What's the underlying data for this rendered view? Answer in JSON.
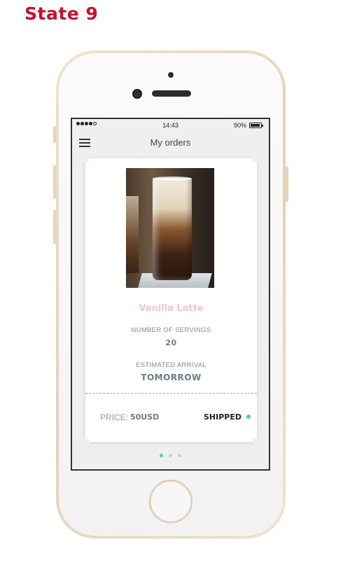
{
  "page": {
    "state_title": "State 9"
  },
  "status_bar": {
    "signal_dots": 5,
    "signal_filled": 4,
    "time": "14:43",
    "battery": "90%"
  },
  "nav": {
    "title": "My orders",
    "menu_icon": "hamburger-menu-icon"
  },
  "order": {
    "product_name": "Vanilla Latte",
    "servings_label": "NUMBER OF SERVINGS",
    "servings_value": "20",
    "arrival_label": "ESTIMATED ARRIVAL",
    "arrival_value": "TOMORROW",
    "price_label": "PRICE:",
    "price_value": "50USD",
    "status": "SHIPPED",
    "status_color": "#4cc3e0",
    "name_color": "#f4c6cf"
  },
  "pager": {
    "count": 3,
    "active_index": 0,
    "active_color": "#4cc3e0"
  },
  "colors": {
    "title_red": "#c8102e",
    "phone_gold": "#e2d3b6"
  }
}
